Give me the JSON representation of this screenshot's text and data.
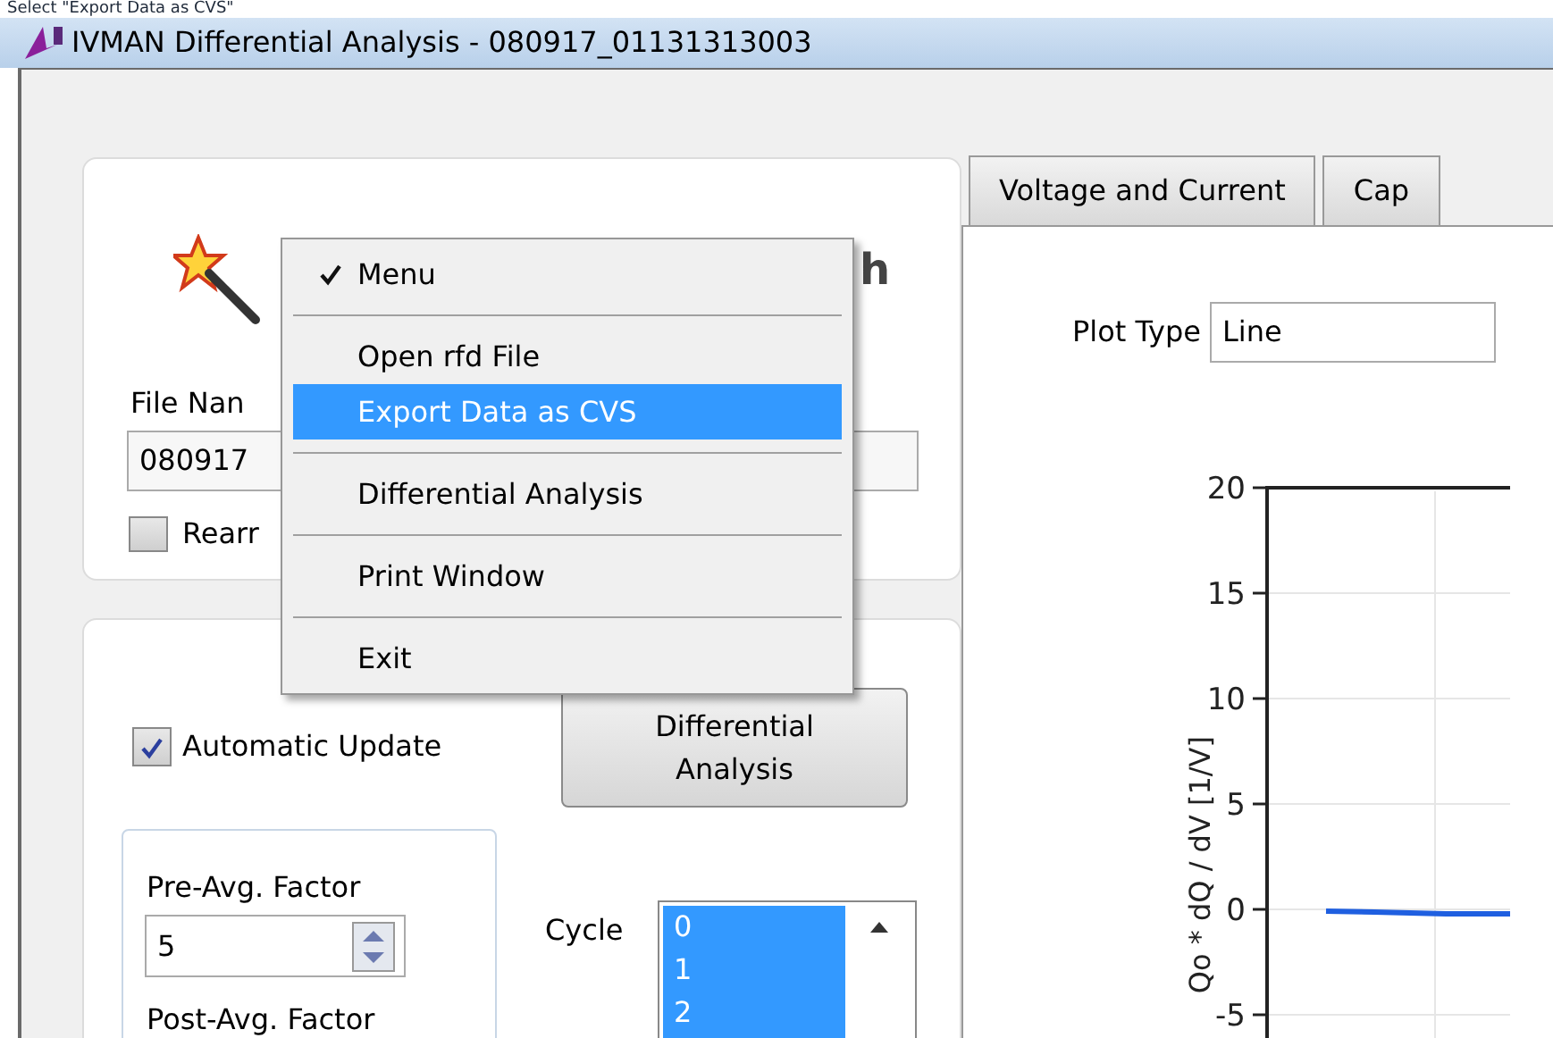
{
  "caption": "Select \"Export Data as CVS\"",
  "window": {
    "title": "IVMAN Differential Analysis - 080917_01131313003"
  },
  "file_panel": {
    "logo_text": "h",
    "file_name_label": "File Nan",
    "file_name_value": "080917",
    "rearrange": {
      "label": "Rearr",
      "checked": false
    }
  },
  "menu": [
    {
      "kind": "item",
      "label": "Menu",
      "checked": true,
      "selected": false
    },
    {
      "kind": "separator"
    },
    {
      "kind": "item",
      "label": "Open rfd File",
      "checked": false,
      "selected": false
    },
    {
      "kind": "item",
      "label": "Export Data as CVS",
      "checked": false,
      "selected": true
    },
    {
      "kind": "separator"
    },
    {
      "kind": "item",
      "label": "Differential Analysis",
      "checked": false,
      "selected": false
    },
    {
      "kind": "separator"
    },
    {
      "kind": "item",
      "label": "Print Window",
      "checked": false,
      "selected": false
    },
    {
      "kind": "separator"
    },
    {
      "kind": "item",
      "label": "Exit",
      "checked": false,
      "selected": false
    }
  ],
  "analysis_panel": {
    "automatic_update": {
      "label": "Automatic Update",
      "checked": true
    },
    "button": "Differential Analysis",
    "pre_avg_label": "Pre-Avg. Factor",
    "pre_avg_value": "5",
    "post_avg_label": "Post-Avg. Factor",
    "cycle_label": "Cycle",
    "cycles": [
      {
        "label": "0",
        "selected": true
      },
      {
        "label": "1",
        "selected": true
      },
      {
        "label": "2",
        "selected": true
      }
    ]
  },
  "tabs": [
    {
      "label": "Voltage and Current",
      "selected": false
    },
    {
      "label": "Cap",
      "selected": false
    }
  ],
  "plot_type": {
    "label": "Plot Type",
    "value": "Line"
  },
  "plot": {
    "ylabel": "Qo * dQ / dV [1/V]",
    "y_tick_labels": [
      "20",
      "15",
      "10",
      "5",
      "0",
      "-5"
    ]
  }
}
